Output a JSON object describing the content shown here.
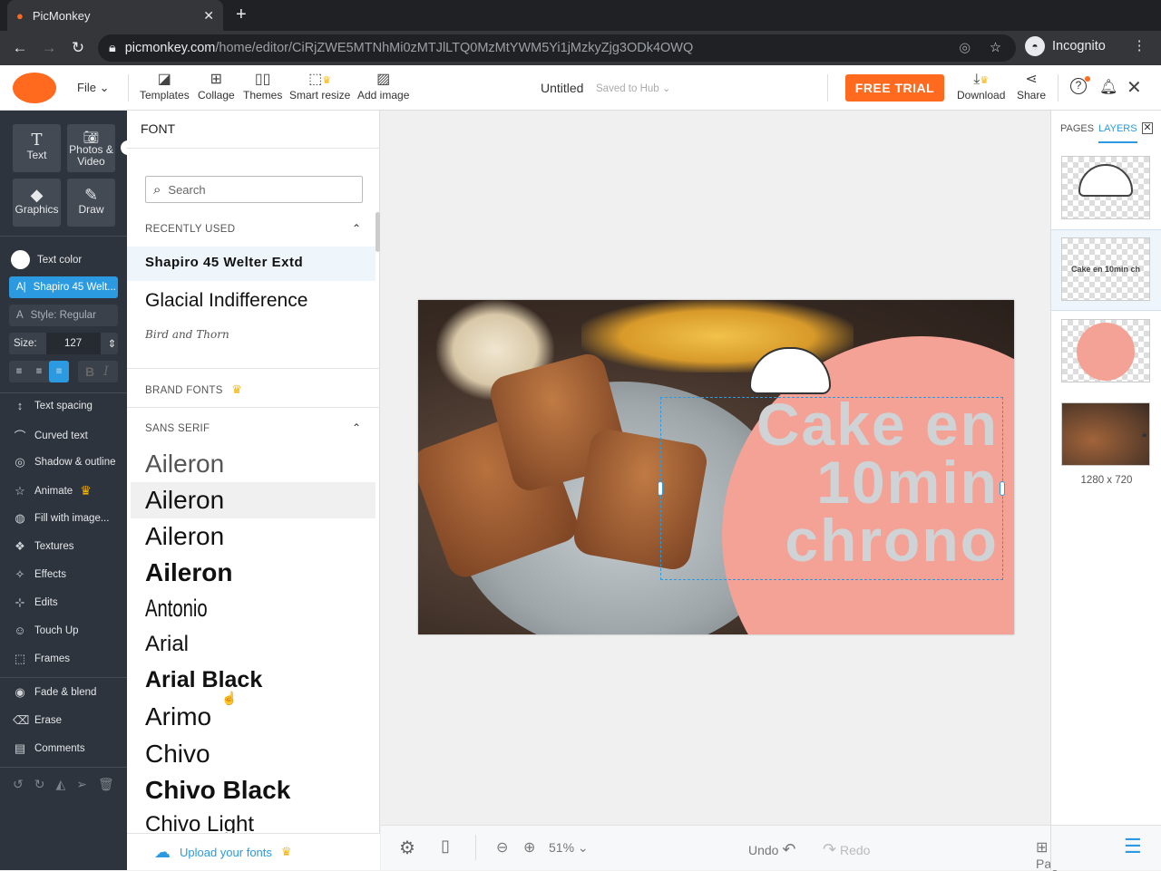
{
  "browser": {
    "tab_title": "PicMonkey",
    "url_host": "picmonkey.com",
    "url_path": "/home/editor/CiRjZWE5MTNhMi0zMTJlLTQ0MzMtYWM5Yi1jMzkyZjg3ODk4OWQ",
    "incognito_label": "Incognito"
  },
  "header": {
    "file_label": "File",
    "tools": [
      {
        "label": "Templates"
      },
      {
        "label": "Collage"
      },
      {
        "label": "Themes"
      },
      {
        "label": "Smart resize"
      },
      {
        "label": "Add image"
      }
    ],
    "doc_title": "Untitled",
    "save_status": "Saved to Hub",
    "free_trial": "FREE TRIAL",
    "download": "Download",
    "share": "Share"
  },
  "left_sidebar": {
    "big_buttons": [
      {
        "label": "Text"
      },
      {
        "label": "Photos & Video"
      },
      {
        "label": "Graphics"
      },
      {
        "label": "Draw"
      }
    ],
    "text_color_label": "Text color",
    "font_selected": "Shapiro 45 Welt...",
    "style_label": "Style: Regular",
    "size_label": "Size:",
    "size_value": "127",
    "menu": [
      {
        "label": "Text spacing"
      },
      {
        "label": "Curved text"
      },
      {
        "label": "Shadow & outline"
      },
      {
        "label": "Animate"
      },
      {
        "label": "Fill with image..."
      },
      {
        "label": "Textures"
      },
      {
        "label": "Effects"
      },
      {
        "label": "Edits"
      },
      {
        "label": "Touch Up"
      },
      {
        "label": "Frames"
      },
      {
        "label": "Fade & blend"
      },
      {
        "label": "Erase"
      },
      {
        "label": "Comments"
      }
    ]
  },
  "font_panel": {
    "title": "FONT",
    "search_placeholder": "Search",
    "recently_used": "RECENTLY USED",
    "recent": [
      "Shapiro 45 Welter Extd",
      "Glacial Indifference",
      "Bird and Thorn"
    ],
    "brand_fonts": "BRAND FONTS",
    "sans_serif": "SANS SERIF",
    "fonts": [
      "Aileron",
      "Aileron",
      "Aileron",
      "Aileron",
      "Antonio",
      "Arial",
      "Arial Black",
      "Arimo",
      "Chivo",
      "Chivo Black",
      "Chivo Light"
    ],
    "upload": "Upload your fonts"
  },
  "canvas": {
    "text_lines": [
      "Cake en",
      "10min",
      "chrono"
    ]
  },
  "bottom": {
    "zoom": "51%",
    "undo": "Undo",
    "redo": "Redo",
    "pages": "Pages"
  },
  "right_panel": {
    "tab_pages": "PAGES",
    "tab_layers": "LAYERS",
    "thumb_text": "Cake en 10min ch",
    "dimensions": "1280 x 720"
  },
  "colors": {
    "accent": "#ff6a1f",
    "blue": "#2b9ae0",
    "sidebar": "#2e343d",
    "pink": "#f4a196"
  }
}
